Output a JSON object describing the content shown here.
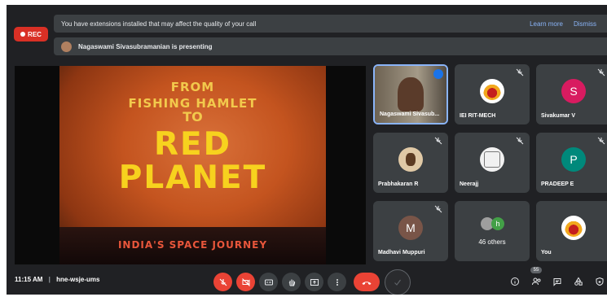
{
  "recording": {
    "label": "REC"
  },
  "banner": {
    "message": "You have extensions installed that may affect the quality of your call",
    "learn_more": "Learn more",
    "dismiss": "Dismiss"
  },
  "presenting": {
    "text": "Nagaswami Sivasubramanian is presenting"
  },
  "slide": {
    "line1": "FROM",
    "line2": "FISHING HAMLET",
    "line3": "TO",
    "line4": "RED",
    "line5": "PLANET",
    "line6": "INDIA'S SPACE JOURNEY"
  },
  "participants": [
    {
      "name": "Nagaswami Sivasub...",
      "avatar": "photo"
    },
    {
      "name": "IEI RIT-MECH",
      "avatar": "logo"
    },
    {
      "name": "Sivakumar V",
      "initial": "S",
      "color": "#d81b60"
    },
    {
      "name": "Prabhakaran R",
      "avatar": "photo"
    },
    {
      "name": "Neerajj",
      "avatar": "sketch"
    },
    {
      "name": "PRADEEP E",
      "initial": "P",
      "color": "#00897b"
    },
    {
      "name": "Madhavi Muppuri",
      "initial": "M",
      "color": "#795548"
    },
    {
      "name": "46 others",
      "initial": "h",
      "color": "#43a047"
    },
    {
      "name": "You",
      "avatar": "logo"
    }
  ],
  "bottom": {
    "time": "11:15 AM",
    "separator": "|",
    "meeting_code": "hne-wsje-ums",
    "people_count": "55"
  },
  "colors": {
    "accent": "#8ab4f8",
    "danger": "#ea4335",
    "surface": "#3c4043",
    "background": "#202124"
  }
}
